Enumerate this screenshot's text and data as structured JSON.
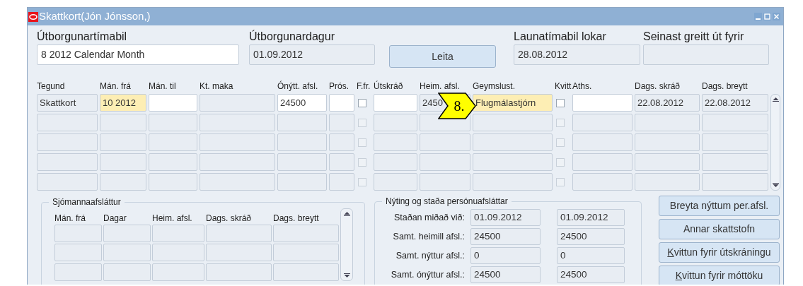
{
  "window": {
    "title": "Skattkort(Jón Jónsson,)"
  },
  "header_fields": [
    {
      "kind": "field",
      "label": "Útborgunartímabil",
      "value": "8 2012 Calendar Month",
      "editable": true
    },
    {
      "kind": "field",
      "label": "Útborgunardagur",
      "value": "01.09.2012",
      "editable": false
    },
    {
      "kind": "button",
      "label": "Leita"
    },
    {
      "kind": "field",
      "label": "Launatímabil lokar",
      "value": "28.08.2012",
      "editable": false
    },
    {
      "kind": "field",
      "label": "Seinast greitt út fyrir",
      "editable": false
    }
  ],
  "table": {
    "columns": [
      {
        "label": "Tegund"
      },
      {
        "label": "Mán. frá"
      },
      {
        "label": "Mán. til"
      },
      {
        "label": "Kt. maka"
      },
      {
        "label": "Ónýtt. afsl."
      },
      {
        "label": "Prós."
      },
      {
        "label": "F.fr."
      },
      {
        "label": "Útskráð"
      },
      {
        "label": "Heim. afsl."
      },
      {
        "label": "Geymslust."
      },
      {
        "label": "Kvitt"
      },
      {
        "label": "Aths."
      },
      {
        "label": "Dags. skráð"
      },
      {
        "label": "Dags. breytt"
      }
    ],
    "rows": [
      {
        "cells": [
          {
            "kind": "text",
            "editable": false,
            "current": false,
            "value": "Skattkort"
          },
          {
            "kind": "text",
            "editable": false,
            "current": true,
            "value": "10 2012"
          },
          {
            "kind": "text",
            "editable": true,
            "current": false
          },
          {
            "kind": "text",
            "editable": false,
            "current": false
          },
          {
            "kind": "text",
            "editable": true,
            "current": false,
            "value": "24500"
          },
          {
            "kind": "text",
            "editable": true,
            "current": false
          },
          {
            "kind": "checkbox",
            "checked": false,
            "disabled": false
          },
          {
            "kind": "text",
            "editable": true,
            "current": false
          },
          {
            "kind": "text",
            "editable": false,
            "current": false,
            "value": "2450"
          },
          {
            "kind": "text",
            "editable": false,
            "current": true,
            "value": "Flugmálastjórn"
          },
          {
            "kind": "checkbox",
            "checked": false,
            "disabled": false
          },
          {
            "kind": "text",
            "editable": true,
            "current": false
          },
          {
            "kind": "text",
            "editable": false,
            "current": false,
            "value": "22.08.2012"
          },
          {
            "kind": "text",
            "editable": false,
            "current": false,
            "value": "22.08.2012"
          }
        ]
      },
      {
        "cells": [
          {
            "kind": "text",
            "editable": false,
            "current": false
          },
          {
            "kind": "text",
            "editable": false,
            "current": false
          },
          {
            "kind": "text",
            "editable": false,
            "current": false
          },
          {
            "kind": "text",
            "editable": false,
            "current": false
          },
          {
            "kind": "text",
            "editable": false,
            "current": false
          },
          {
            "kind": "text",
            "editable": false,
            "current": false
          },
          {
            "kind": "checkbox",
            "checked": false,
            "disabled": true
          },
          {
            "kind": "text",
            "editable": false,
            "current": false
          },
          {
            "kind": "text",
            "editable": false,
            "current": false
          },
          {
            "kind": "text",
            "editable": false,
            "current": false
          },
          {
            "kind": "checkbox",
            "checked": false,
            "disabled": true
          },
          {
            "kind": "text",
            "editable": false,
            "current": false
          },
          {
            "kind": "text",
            "editable": false,
            "current": false
          },
          {
            "kind": "text",
            "editable": false,
            "current": false
          }
        ]
      },
      {
        "cells": [
          {
            "kind": "text",
            "editable": false,
            "current": false
          },
          {
            "kind": "text",
            "editable": false,
            "current": false
          },
          {
            "kind": "text",
            "editable": false,
            "current": false
          },
          {
            "kind": "text",
            "editable": false,
            "current": false
          },
          {
            "kind": "text",
            "editable": false,
            "current": false
          },
          {
            "kind": "text",
            "editable": false,
            "current": false
          },
          {
            "kind": "checkbox",
            "checked": false,
            "disabled": true
          },
          {
            "kind": "text",
            "editable": false,
            "current": false
          },
          {
            "kind": "text",
            "editable": false,
            "current": false
          },
          {
            "kind": "text",
            "editable": false,
            "current": false
          },
          {
            "kind": "checkbox",
            "checked": false,
            "disabled": true
          },
          {
            "kind": "text",
            "editable": false,
            "current": false
          },
          {
            "kind": "text",
            "editable": false,
            "current": false
          },
          {
            "kind": "text",
            "editable": false,
            "current": false
          }
        ]
      },
      {
        "cells": [
          {
            "kind": "text",
            "editable": false,
            "current": false
          },
          {
            "kind": "text",
            "editable": false,
            "current": false
          },
          {
            "kind": "text",
            "editable": false,
            "current": false
          },
          {
            "kind": "text",
            "editable": false,
            "current": false
          },
          {
            "kind": "text",
            "editable": false,
            "current": false
          },
          {
            "kind": "text",
            "editable": false,
            "current": false
          },
          {
            "kind": "checkbox",
            "checked": false,
            "disabled": true
          },
          {
            "kind": "text",
            "editable": false,
            "current": false
          },
          {
            "kind": "text",
            "editable": false,
            "current": false
          },
          {
            "kind": "text",
            "editable": false,
            "current": false
          },
          {
            "kind": "checkbox",
            "checked": false,
            "disabled": true
          },
          {
            "kind": "text",
            "editable": false,
            "current": false
          },
          {
            "kind": "text",
            "editable": false,
            "current": false
          },
          {
            "kind": "text",
            "editable": false,
            "current": false
          }
        ]
      },
      {
        "cells": [
          {
            "kind": "text",
            "editable": false,
            "current": false
          },
          {
            "kind": "text",
            "editable": false,
            "current": false
          },
          {
            "kind": "text",
            "editable": false,
            "current": false
          },
          {
            "kind": "text",
            "editable": false,
            "current": false
          },
          {
            "kind": "text",
            "editable": false,
            "current": false
          },
          {
            "kind": "text",
            "editable": false,
            "current": false
          },
          {
            "kind": "checkbox",
            "checked": false,
            "disabled": true
          },
          {
            "kind": "text",
            "editable": false,
            "current": false
          },
          {
            "kind": "text",
            "editable": false,
            "current": false
          },
          {
            "kind": "text",
            "editable": false,
            "current": false
          },
          {
            "kind": "checkbox",
            "checked": false,
            "disabled": true
          },
          {
            "kind": "text",
            "editable": false,
            "current": false
          },
          {
            "kind": "text",
            "editable": false,
            "current": false
          },
          {
            "kind": "text",
            "editable": false,
            "current": false
          }
        ]
      }
    ]
  },
  "callout": {
    "label": "8."
  },
  "seamen_discount": {
    "title": "Sjómannaafsláttur",
    "columns": [
      {
        "label": "Mán. frá"
      },
      {
        "label": "Dagar"
      },
      {
        "label": "Heim. afsl."
      },
      {
        "label": "Dags. skráð"
      },
      {
        "label": "Dags. breytt"
      }
    ],
    "rows": [
      {
        "cells": [
          {
            "editable": false
          },
          {
            "editable": false
          },
          {
            "editable": false
          },
          {
            "editable": false
          },
          {
            "editable": false
          }
        ]
      },
      {
        "cells": [
          {
            "editable": false
          },
          {
            "editable": false
          },
          {
            "editable": false
          },
          {
            "editable": false
          },
          {
            "editable": false
          }
        ]
      },
      {
        "cells": [
          {
            "editable": false
          },
          {
            "editable": false
          },
          {
            "editable": false
          },
          {
            "editable": false
          },
          {
            "editable": false
          }
        ]
      }
    ]
  },
  "personal_discount": {
    "title": "Nýting og staða persónuafsláttar",
    "rows": [
      {
        "label": "Staðan miðað við:",
        "values": [
          "01.09.2012",
          "01.09.2012"
        ]
      },
      {
        "label": "Samt. heimill afsl.:",
        "values": [
          "24500",
          "24500"
        ]
      },
      {
        "label": "Samt. nýttur afsl.:",
        "values": [
          "0",
          "0"
        ]
      },
      {
        "label": "Samt. ónýttur afsl.:",
        "values": [
          "24500",
          "24500"
        ]
      }
    ]
  },
  "buttons": [
    {
      "label": "Breyta nýttum per.afsl.",
      "mnemonic": false
    },
    {
      "label": "Annar skattstofn",
      "mnemonic": false
    },
    {
      "label": "Kvittun fyrir útskráningu",
      "mnemonic": true
    },
    {
      "label": "Kvittun fyrir móttöku",
      "mnemonic": true
    }
  ]
}
